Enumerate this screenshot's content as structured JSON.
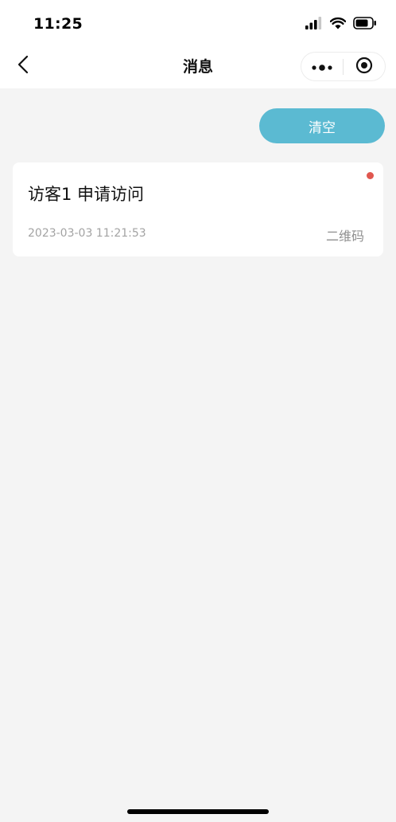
{
  "status_bar": {
    "time": "11:25",
    "icons": [
      "signal-icon",
      "wifi-icon",
      "battery-icon"
    ]
  },
  "nav": {
    "title": "消息",
    "back_icon": "chevron-left-icon",
    "more_icon": "more-dots-icon",
    "close_icon": "target-icon"
  },
  "actions": {
    "clear_label": "清空"
  },
  "messages": [
    {
      "title": "访客1 申请访问",
      "time": "2023-03-03 11:21:53",
      "type": "二维码",
      "unread": true
    }
  ],
  "colors": {
    "accent": "#5bbad2",
    "unread_dot": "#e0574f",
    "background": "#f4f4f4"
  }
}
